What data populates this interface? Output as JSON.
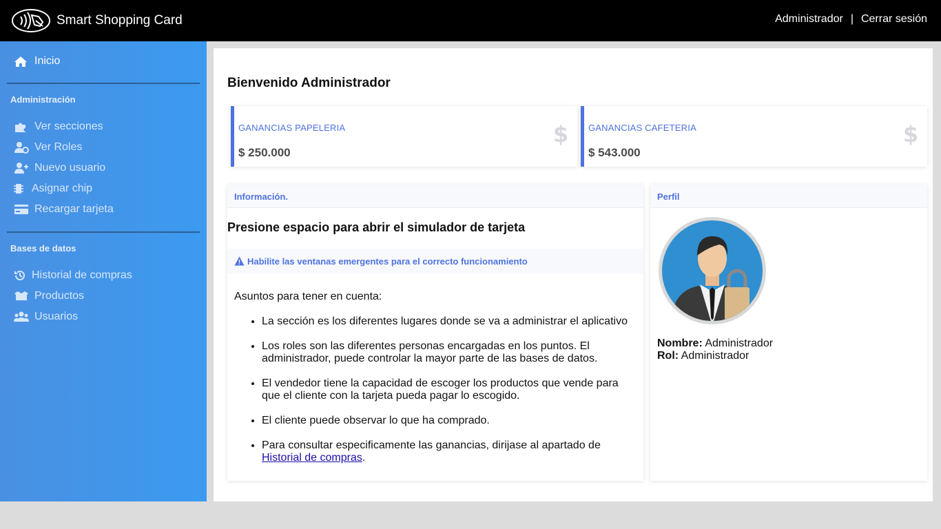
{
  "topbar": {
    "app_title": "Smart Shopping Card",
    "user_link": "Administrador",
    "separator": "|",
    "logout_link": "Cerrar sesión"
  },
  "sidebar": {
    "home_label": "Inicio",
    "section_admin": "Administración",
    "admin_items": [
      {
        "label": "Ver secciones",
        "icon": "puzzle-icon"
      },
      {
        "label": "Ver Roles",
        "icon": "user-roles-icon"
      },
      {
        "label": "Nuevo usuario",
        "icon": "user-plus-icon"
      },
      {
        "label": "Asignar chip",
        "icon": "chip-icon"
      },
      {
        "label": "Recargar tarjeta",
        "icon": "credit-card-icon"
      }
    ],
    "section_db": "Bases de datos",
    "db_items": [
      {
        "label": "Historial de compras",
        "icon": "history-icon"
      },
      {
        "label": "Productos",
        "icon": "boxes-icon"
      },
      {
        "label": "Usuarios",
        "icon": "users-icon"
      }
    ]
  },
  "main": {
    "welcome": "Bienvenido Administrador",
    "cards": [
      {
        "label": "GANANCIAS PAPELERIA",
        "value": "$ 250.000",
        "icon": "dollar-icon"
      },
      {
        "label": "GANANCIAS CAFETERIA",
        "value": "$ 543.000",
        "icon": "dollar-icon"
      }
    ],
    "info": {
      "header": "Información.",
      "title": "Presione espacio para abrir el simulador de tarjeta",
      "warning": "Habilite las ventanas emergentes para el correcto funcionamiento",
      "intro": "Asuntos para tener en cuenta:",
      "items": [
        "La sección es los diferentes lugares donde se va a administrar el aplicativo",
        "Los roles son las diferentes personas encargadas en los puntos. El administrador, puede controlar la mayor parte de las bases de datos.",
        "El vendedor tiene la capacidad de escoger los productos que vende para que el cliente con la tarjeta pueda pagar lo escogido.",
        "El cliente puede observar lo que ha comprado.",
        "Para consultar especificamente las ganancias, dirijase al apartado de"
      ],
      "last_link": "Historial de compras",
      "last_suffix": "."
    },
    "profile": {
      "header": "Perfil",
      "name_label": "Nombre:",
      "name_value": "Administrador",
      "role_label": "Rol:",
      "role_value": "Administrador"
    }
  },
  "colors": {
    "topbar": "#000000",
    "sidebar": "#3b9af0",
    "accent": "#4e73df"
  }
}
